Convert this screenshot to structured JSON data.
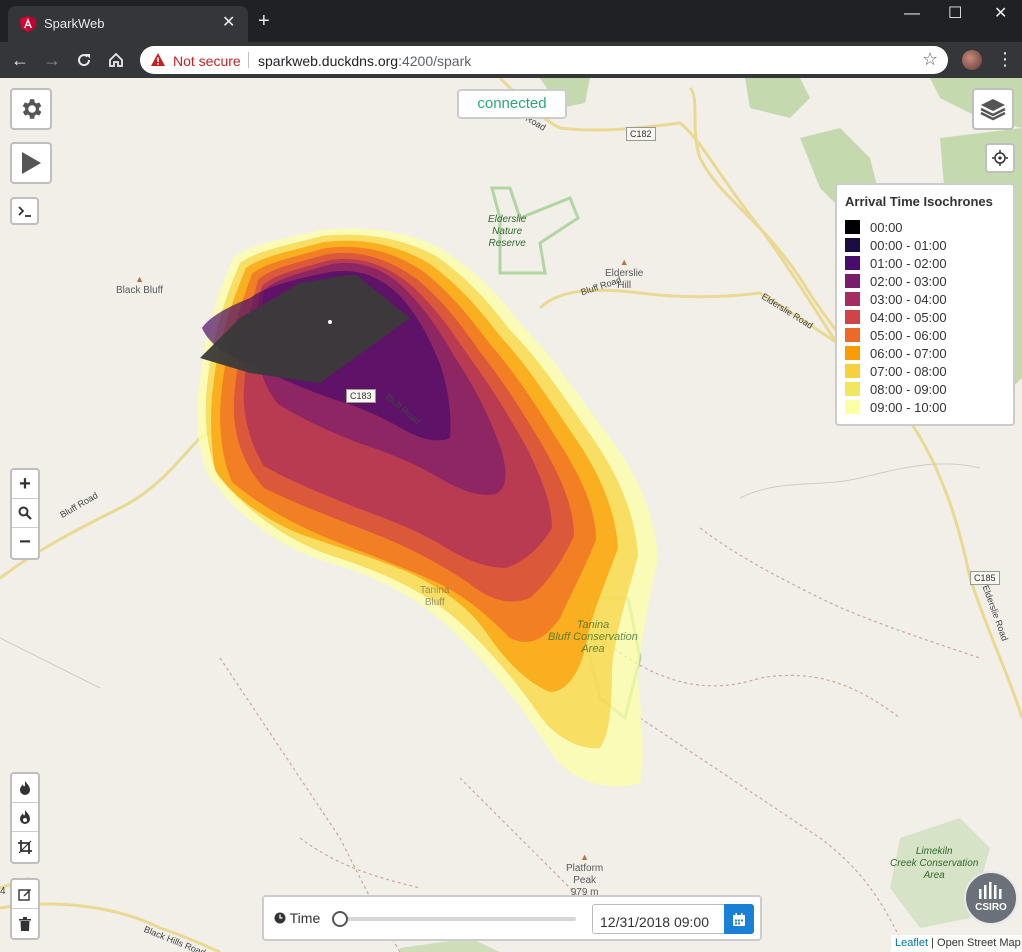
{
  "browser": {
    "tab_title": "SparkWeb",
    "tab_close": "✕",
    "new_tab": "+",
    "security_label": "Not secure",
    "url_host": "sparkweb.duckdns.org",
    "url_rest": ":4200/spark",
    "window_minimize": "—",
    "window_maximize": "☐",
    "window_close": "✕"
  },
  "status": {
    "connection": "connected"
  },
  "map_labels": {
    "black_bluff": "Black Bluff",
    "eldersle_nature_reserve": "Elderslie\nNature\nReserve",
    "elderslie_hill": "Elderslie\nHill",
    "tanina_bluff": "Tanina\nBluff",
    "tanina_conservation": "Tanina\nBluff Conservation\nArea",
    "platform_peak": "Platform\nPeak\n979 m",
    "limekiln": "Limekiln\nCreek Conservation\nArea",
    "road_c182": "C182",
    "road_c183": "C183",
    "road_c185": "C185",
    "bluff_road_1": "Bluff Road",
    "bluff_road_2": "Bluff Road",
    "bluff_road_3": "Bluff Road",
    "elderslie_road_1": "Elderslie Road",
    "elderslie_road_2": "Elderslie Road",
    "black_hills_road": "Black Hills Road",
    "n_road": "n Road",
    "edge_marker": "4"
  },
  "legend": {
    "title": "Arrival Time Isochrones",
    "items": [
      {
        "label": "00:00",
        "color": "#000004"
      },
      {
        "label": "00:00 - 01:00",
        "color": "#1b0c41"
      },
      {
        "label": "01:00 - 02:00",
        "color": "#4a0c6b"
      },
      {
        "label": "02:00 - 03:00",
        "color": "#781c6d"
      },
      {
        "label": "03:00 - 04:00",
        "color": "#a52c60"
      },
      {
        "label": "04:00 - 05:00",
        "color": "#cf4446"
      },
      {
        "label": "05:00 - 06:00",
        "color": "#ed6925"
      },
      {
        "label": "06:00 - 07:00",
        "color": "#fb9b06"
      },
      {
        "label": "07:00 - 08:00",
        "color": "#f7d13d"
      },
      {
        "label": "08:00 - 09:00",
        "color": "#f2e55f"
      },
      {
        "label": "09:00 - 10:00",
        "color": "#fcffa4"
      }
    ]
  },
  "time_control": {
    "label": "Time",
    "datetime": "12/31/2018 09:00",
    "slider_fraction": 0.0
  },
  "attribution": {
    "leaflet": "Leaflet",
    "separator": "|",
    "osm": "Open Street Map"
  },
  "logo": {
    "text": "CSIRO"
  },
  "colors": {
    "connected_text": "#2aa876",
    "accent_button": "#1a7fd6",
    "map_background": "#f2efe9",
    "park_green": "#b5d29a"
  }
}
